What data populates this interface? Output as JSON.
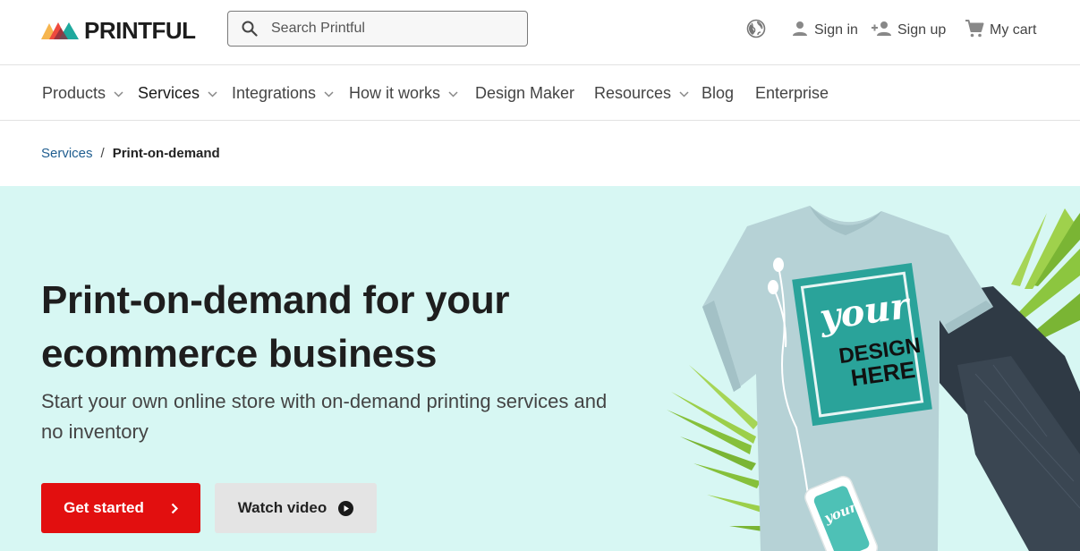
{
  "brand": {
    "name": "PRINTFUL"
  },
  "search": {
    "placeholder": "Search Printful"
  },
  "header_actions": {
    "sign_in": "Sign in",
    "sign_up": "Sign up",
    "cart": "My cart"
  },
  "nav": {
    "items": [
      {
        "label": "Products",
        "has_dropdown": true
      },
      {
        "label": "Services",
        "has_dropdown": true,
        "active": true
      },
      {
        "label": "Integrations",
        "has_dropdown": true
      },
      {
        "label": "How it works",
        "has_dropdown": true
      },
      {
        "label": "Design Maker",
        "has_dropdown": false
      },
      {
        "label": "Resources",
        "has_dropdown": true
      },
      {
        "label": "Blog",
        "has_dropdown": false
      },
      {
        "label": "Enterprise",
        "has_dropdown": false
      }
    ]
  },
  "breadcrumb": {
    "parent": "Services",
    "separator": "/",
    "current": "Print-on-demand"
  },
  "hero": {
    "title_line1": "Print-on-demand for your",
    "title_line2": "ecommerce business",
    "subtitle": "Start your own online store with on-demand printing services and no inventory",
    "primary_cta": "Get started",
    "secondary_cta": "Watch video",
    "shirt_text_1": "your",
    "shirt_text_2": "DESIGN",
    "shirt_text_3": "HERE",
    "case_text": "your"
  },
  "colors": {
    "hero_bg": "#d7f7f3",
    "primary_cta": "#e20f0f",
    "secondary_cta": "#e4e4e4",
    "link": "#1f5d8f",
    "design_teal": "#2aa39a"
  }
}
